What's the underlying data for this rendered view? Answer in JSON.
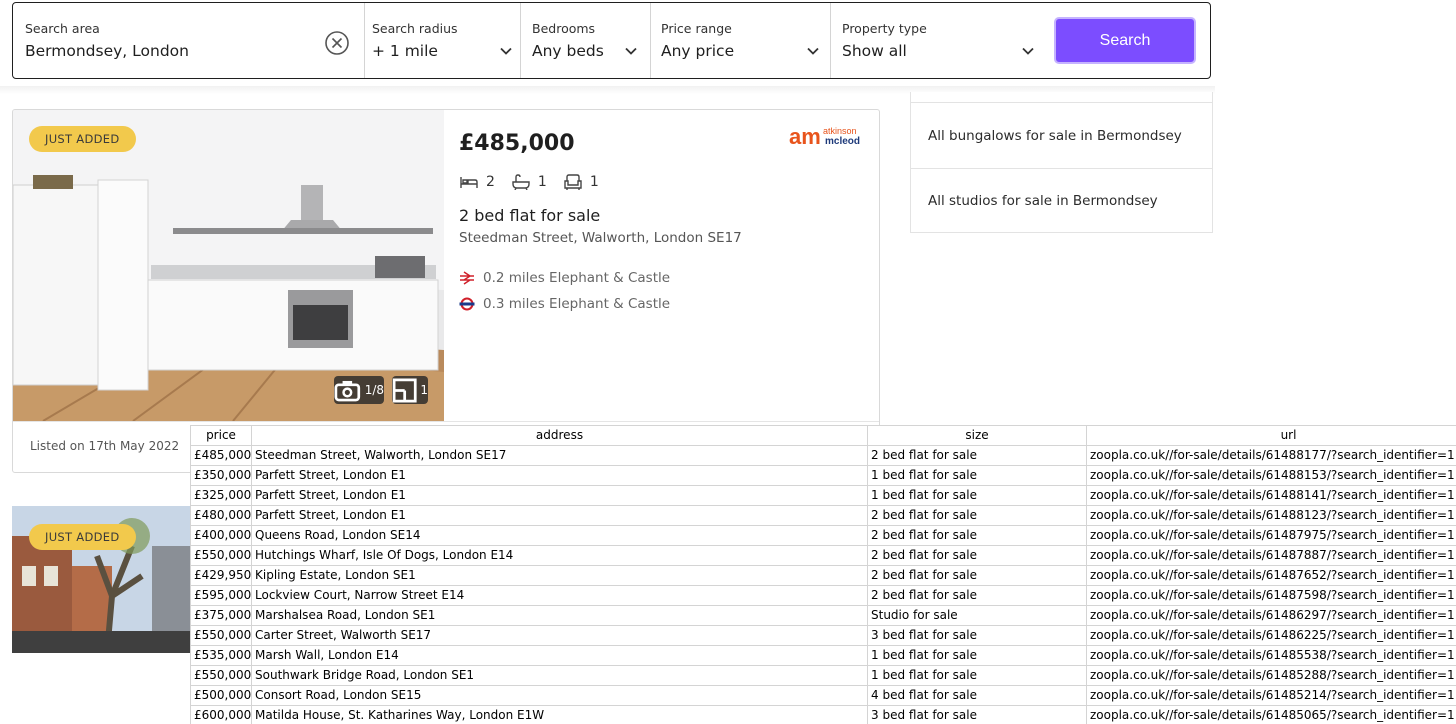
{
  "search": {
    "area_label": "Search area",
    "area_value": "Bermondsey, London",
    "radius_label": "Search radius",
    "radius_value": "+ 1 mile",
    "bedrooms_label": "Bedrooms",
    "bedrooms_value": "Any beds",
    "price_label": "Price range",
    "price_value": "Any price",
    "type_label": "Property type",
    "type_value": "Show all",
    "button_label": "Search",
    "button_color": "#7c4dff"
  },
  "listing": {
    "badge": "JUST ADDED",
    "photo_count": "1/8",
    "floorplan_count": "1",
    "price": "£485,000",
    "agent_logo_mark": "am",
    "agent_logo_line1": "atkinson",
    "agent_logo_line2": "mcleod",
    "beds": "2",
    "baths": "1",
    "receptions": "1",
    "title": "2 bed flat for sale",
    "address": "Steedman Street, Walworth, London SE17",
    "rail": "0.2 miles Elephant & Castle",
    "tube": "0.3 miles Elephant & Castle",
    "listed": "Listed on 17th May 2022"
  },
  "listing2": {
    "badge": "JUST ADDED"
  },
  "side_links": [
    "All bungalows for sale in Bermondsey",
    "All studios for sale in Bermondsey"
  ],
  "sheet": {
    "headers": [
      "price",
      "address",
      "size",
      "url"
    ],
    "rows": [
      [
        "£485,000",
        "Steedman Street, Walworth, London SE17",
        "2 bed flat for sale",
        "zoopla.co.uk//for-sale/details/61488177/?search_identifier=1"
      ],
      [
        "£350,000",
        "Parfett Street, London E1",
        "1 bed flat for sale",
        "zoopla.co.uk//for-sale/details/61488153/?search_identifier=1"
      ],
      [
        "£325,000",
        "Parfett Street, London E1",
        "1 bed flat for sale",
        "zoopla.co.uk//for-sale/details/61488141/?search_identifier=1"
      ],
      [
        "£480,000",
        "Parfett Street, London E1",
        "2 bed flat for sale",
        "zoopla.co.uk//for-sale/details/61488123/?search_identifier=1"
      ],
      [
        "£400,000",
        "Queens Road, London SE14",
        "2 bed flat for sale",
        "zoopla.co.uk//for-sale/details/61487975/?search_identifier=1"
      ],
      [
        "£550,000",
        "Hutchings Wharf, Isle Of Dogs, London E14",
        "2 bed flat for sale",
        "zoopla.co.uk//for-sale/details/61487887/?search_identifier=1"
      ],
      [
        "£429,950",
        "Kipling Estate, London SE1",
        "2 bed flat for sale",
        "zoopla.co.uk//for-sale/details/61487652/?search_identifier=1"
      ],
      [
        "£595,000",
        "Lockview Court, Narrow Street E14",
        "2 bed flat for sale",
        "zoopla.co.uk//for-sale/details/61487598/?search_identifier=1"
      ],
      [
        "£375,000",
        "Marshalsea Road, London SE1",
        "Studio for sale",
        "zoopla.co.uk//for-sale/details/61486297/?search_identifier=1"
      ],
      [
        "£550,000",
        "Carter Street, Walworth SE17",
        "3 bed flat for sale",
        "zoopla.co.uk//for-sale/details/61486225/?search_identifier=1"
      ],
      [
        "£535,000",
        "Marsh Wall, London E14",
        "1 bed flat for sale",
        "zoopla.co.uk//for-sale/details/61485538/?search_identifier=1"
      ],
      [
        "£550,000",
        "Southwark Bridge Road, London SE1",
        "1 bed flat for sale",
        "zoopla.co.uk//for-sale/details/61485288/?search_identifier=1"
      ],
      [
        "£500,000",
        "Consort Road, London SE15",
        "4 bed flat for sale",
        "zoopla.co.uk//for-sale/details/61485214/?search_identifier=1"
      ],
      [
        "£600,000",
        "Matilda House, St. Katharines Way, London E1W",
        "3 bed flat for sale",
        "zoopla.co.uk//for-sale/details/61485065/?search_identifier=1"
      ]
    ]
  }
}
